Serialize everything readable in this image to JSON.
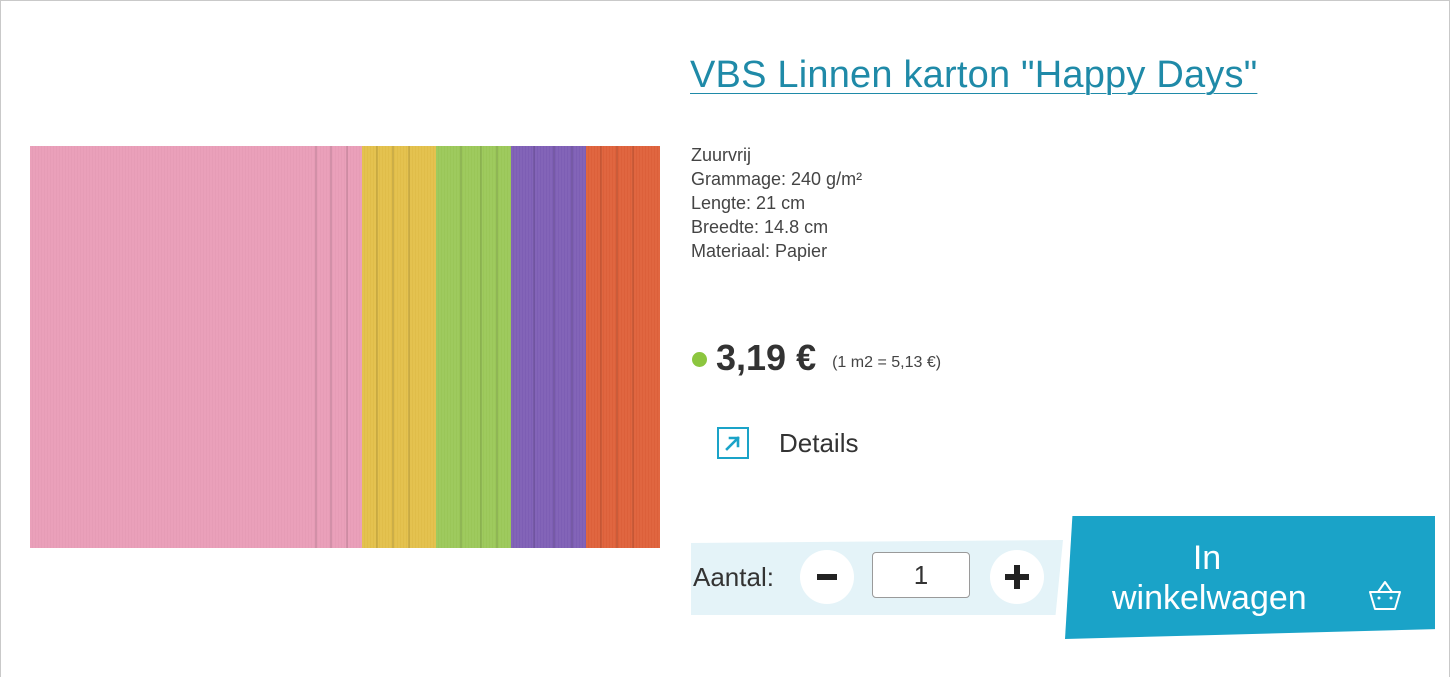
{
  "product": {
    "title": "VBS Linnen karton \"Happy Days\"",
    "image_colors": [
      "#e99eb8",
      "#e3c04a",
      "#9cc95a",
      "#7f5fb6",
      "#e0623a"
    ],
    "specs": [
      "Zuurvrij",
      "Grammage: 240 g/m²",
      "Lengte: 21 cm",
      "Breedte: 14.8 cm",
      "Materiaal: Papier"
    ],
    "price": "3,19 €",
    "unit_price": "(1 m2 = 5,13 €)",
    "stock_color": "#8cc63f"
  },
  "details": {
    "label": "Details",
    "icon": "external-arrow-icon"
  },
  "quantity": {
    "label": "Aantal:",
    "value": "1",
    "minus_icon": "minus-icon",
    "plus_icon": "plus-icon"
  },
  "cart": {
    "line1": "In",
    "line2": "winkelwagen",
    "icon": "basket-icon",
    "color": "#1aa3c8"
  }
}
